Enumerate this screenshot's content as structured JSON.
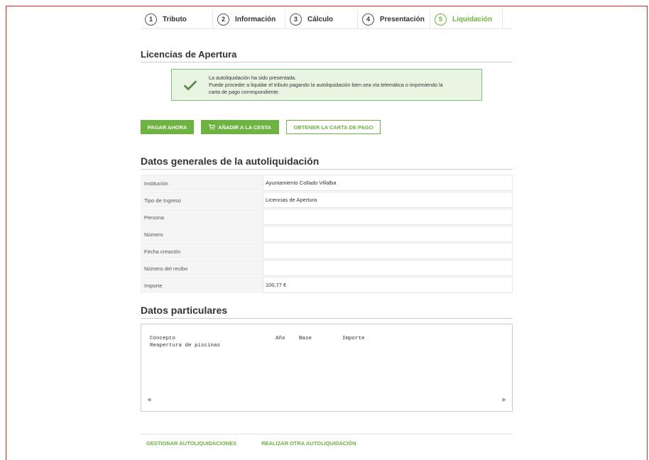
{
  "steps": [
    {
      "num": "1",
      "label": "Tributo"
    },
    {
      "num": "2",
      "label": "Información"
    },
    {
      "num": "3",
      "label": "Cálculo"
    },
    {
      "num": "4",
      "label": "Presentación"
    },
    {
      "num": "5",
      "label": "Liquidación"
    }
  ],
  "section_title": "Licencias de Apertura",
  "alert": {
    "line1": "La autoliquidación ha sido presentada.",
    "line2": "Puede proceder a liquidar el tributo pagando la autoliquidación bien sea vía telemática o imprimiendo la",
    "line3": "carta de pago correspondiente."
  },
  "buttons": {
    "pay": "PAGAR AHORA",
    "cart": "AÑADIR A LA CESTA",
    "letter": "OBTENER LA CARTA DE PAGO"
  },
  "general": {
    "title": "Datos generales de la autoliquidación",
    "rows": [
      {
        "label": "Institución",
        "value": "Ayuntamiento Collado Villalba"
      },
      {
        "label": "Tipo de Ingreso",
        "value": "Licencias de Apertura"
      },
      {
        "label": "Persona",
        "value": ""
      },
      {
        "label": "Número",
        "value": ""
      },
      {
        "label": "Fecha creación",
        "value": ""
      },
      {
        "label": "Número del recibo",
        "value": ""
      },
      {
        "label": "Importe",
        "value": "100,77 €"
      }
    ]
  },
  "particular": {
    "title": "Datos particulares",
    "headers": {
      "concepto": "Concepto",
      "anio": "Año",
      "base": "Base",
      "importe": "Importe"
    },
    "row1": "Reapertura de piscinas"
  },
  "footer": {
    "manage": "GESTIONAR AUTOLIQUIDACIONES",
    "another": "REALIZAR OTRA AUTOLIQUIDACIÓN"
  },
  "colors": {
    "accent": "#6db33f",
    "frame": "#e0281e"
  }
}
